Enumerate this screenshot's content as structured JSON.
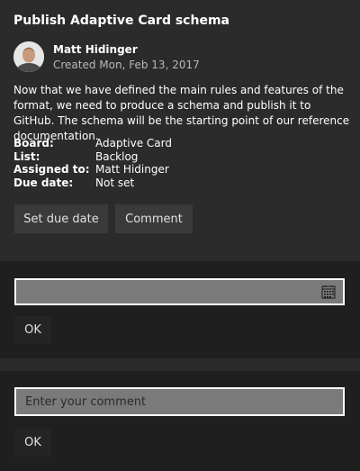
{
  "card": {
    "title": "Publish Adaptive Card schema",
    "author": {
      "name": "Matt Hidinger",
      "created": "Created Mon, Feb 13, 2017"
    },
    "description": "Now that we have defined the main rules and features of the format, we need to produce a schema and publish it to GitHub. The schema will be the starting point of our reference documentation.",
    "facts": [
      {
        "key": "Board:",
        "value": "Adaptive Card"
      },
      {
        "key": "List:",
        "value": "Backlog"
      },
      {
        "key": "Assigned to:",
        "value": "Matt Hidinger"
      },
      {
        "key": "Due date:",
        "value": "Not set"
      }
    ],
    "actions": {
      "due_date_label": "Set due date",
      "comment_label": "Comment"
    }
  },
  "due_date_panel": {
    "input_value": "",
    "icon": "calendar-icon",
    "ok_label": "OK"
  },
  "comment_panel": {
    "placeholder": "Enter your comment",
    "ok_label": "OK"
  }
}
